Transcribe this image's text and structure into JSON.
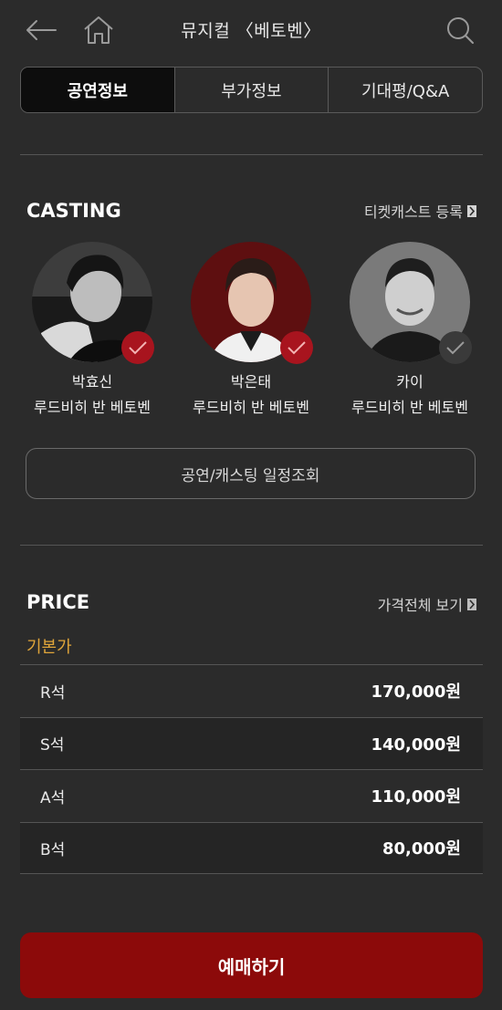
{
  "header": {
    "title": "뮤지컬 〈베토벤〉",
    "back_icon": "arrow-left-icon",
    "home_icon": "home-icon",
    "search_icon": "search-icon"
  },
  "tabs": [
    {
      "label": "공연정보",
      "active": true
    },
    {
      "label": "부가정보",
      "active": false
    },
    {
      "label": "기대평/Q&A",
      "active": false
    }
  ],
  "casting": {
    "title": "CASTING",
    "link_label": "티켓캐스트 등록",
    "members": [
      {
        "name": "박효신",
        "role": "루드비히 반 베토벤",
        "checked": true
      },
      {
        "name": "박은태",
        "role": "루드비히 반 베토벤",
        "checked": true
      },
      {
        "name": "카이",
        "role": "루드비히 반 베토벤",
        "checked": false
      }
    ],
    "schedule_button": "공연/캐스팅 일정조회"
  },
  "price": {
    "title": "PRICE",
    "link_label": "가격전체 보기",
    "basic_label": "기본가",
    "rows": [
      {
        "seat": "R석",
        "price": "170,000원"
      },
      {
        "seat": "S석",
        "price": "140,000원"
      },
      {
        "seat": "A석",
        "price": "110,000원"
      },
      {
        "seat": "B석",
        "price": "80,000원"
      }
    ]
  },
  "book_button": "예매하기",
  "colors": {
    "background": "#2b2b2b",
    "accent_red": "#8c0a0a",
    "check_red": "#a8141e",
    "basic_price_orange": "#e0a53a"
  }
}
